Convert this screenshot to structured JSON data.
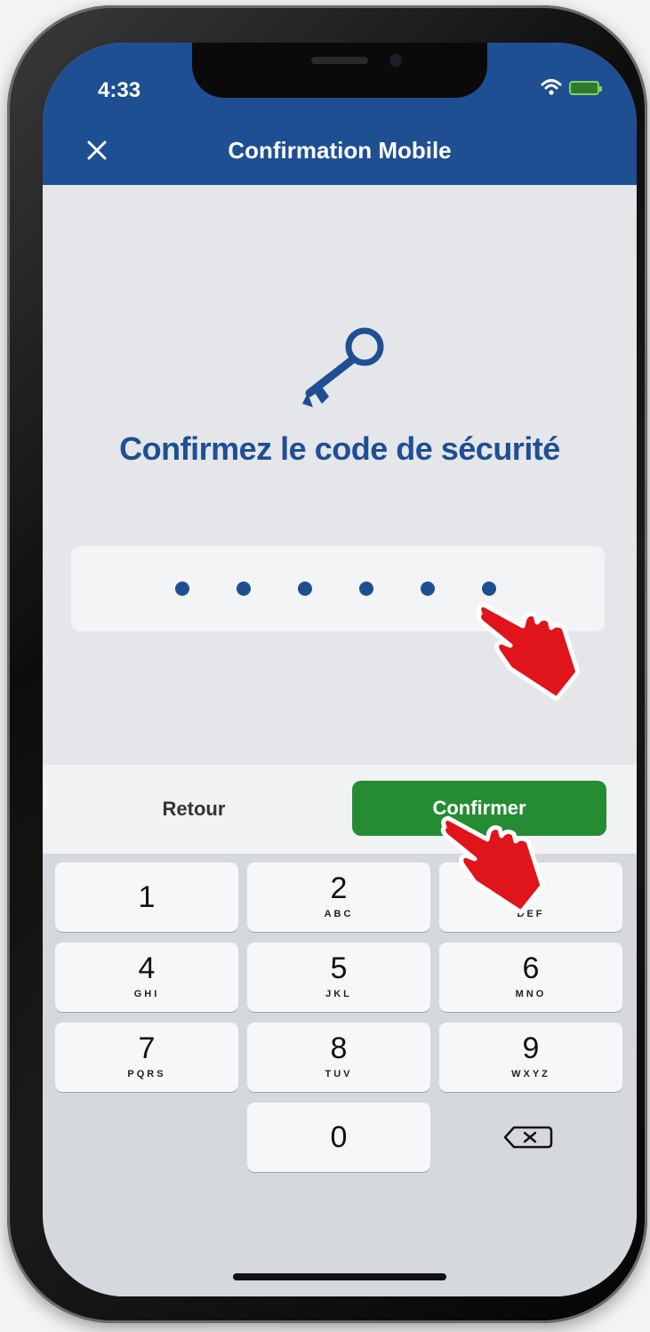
{
  "status_bar": {
    "time": "4:33"
  },
  "header": {
    "title": "Confirmation Mobile"
  },
  "main": {
    "heading": "Confirmez le code de sécurité",
    "code_dots": 6
  },
  "actions": {
    "back_label": "Retour",
    "confirm_label": "Confirmer"
  },
  "keypad": {
    "keys": [
      {
        "digit": "1",
        "letters": ""
      },
      {
        "digit": "2",
        "letters": "ABC"
      },
      {
        "digit": "3",
        "letters": "DEF"
      },
      {
        "digit": "4",
        "letters": "GHI"
      },
      {
        "digit": "5",
        "letters": "JKL"
      },
      {
        "digit": "6",
        "letters": "MNO"
      },
      {
        "digit": "7",
        "letters": "PQRS"
      },
      {
        "digit": "8",
        "letters": "TUV"
      },
      {
        "digit": "9",
        "letters": "WXYZ"
      },
      {
        "digit": "0",
        "letters": ""
      }
    ]
  },
  "colors": {
    "header": "#1f4f93",
    "accent_text": "#1f4f93",
    "confirm_button": "#268c33",
    "hand_overlay": "#e0141b"
  },
  "icons": {
    "close": "close-icon",
    "key": "key-icon",
    "backspace": "backspace-icon",
    "hand": "hand-pointer-icon"
  }
}
